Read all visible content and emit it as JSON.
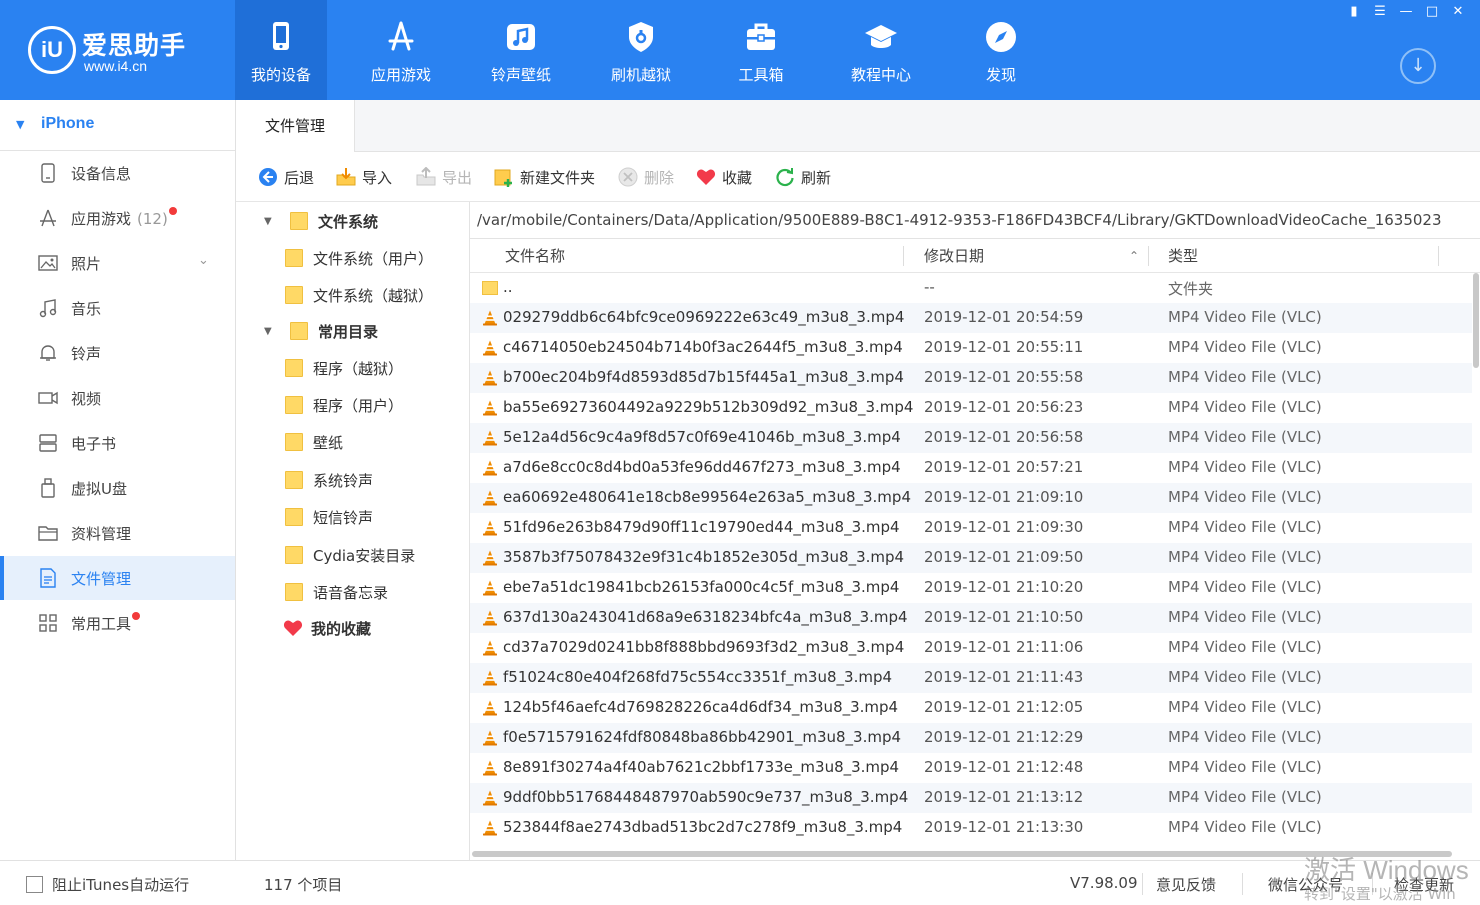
{
  "app": {
    "logo_mark": "iU",
    "logo_name": "爱思助手",
    "logo_url": "www.i4.cn"
  },
  "nav": [
    {
      "label": "我的设备",
      "icon": "phone-icon"
    },
    {
      "label": "应用游戏",
      "icon": "appstore-icon"
    },
    {
      "label": "铃声壁纸",
      "icon": "music-icon"
    },
    {
      "label": "刷机越狱",
      "icon": "shield-icon"
    },
    {
      "label": "工具箱",
      "icon": "toolbox-icon"
    },
    {
      "label": "教程中心",
      "icon": "graduation-cap-icon"
    },
    {
      "label": "发现",
      "icon": "compass-icon"
    }
  ],
  "sidebar": {
    "device_name": "iPhone",
    "items": [
      {
        "label": "设备信息",
        "icon": "device-info-icon"
      },
      {
        "label": "应用游戏",
        "icon": "apps-icon",
        "count": "(12)",
        "badge": true
      },
      {
        "label": "照片",
        "icon": "photo-icon",
        "expandable": true
      },
      {
        "label": "音乐",
        "icon": "music-note-icon"
      },
      {
        "label": "铃声",
        "icon": "bell-icon"
      },
      {
        "label": "视频",
        "icon": "video-icon"
      },
      {
        "label": "电子书",
        "icon": "ebook-icon"
      },
      {
        "label": "虚拟U盘",
        "icon": "usb-drive-icon"
      },
      {
        "label": "资料管理",
        "icon": "folder-icon"
      },
      {
        "label": "文件管理",
        "icon": "file-manager-icon",
        "active": true
      },
      {
        "label": "常用工具",
        "icon": "grid-tools-icon",
        "badge": true
      }
    ]
  },
  "tabs": {
    "active": "文件管理"
  },
  "toolbar": {
    "back": "后退",
    "import": "导入",
    "export": "导出",
    "new_folder": "新建文件夹",
    "delete": "删除",
    "favorite": "收藏",
    "refresh": "刷新"
  },
  "tree": {
    "filesystem": "文件系统",
    "fs_user": "文件系统（用户）",
    "fs_jailbreak": "文件系统（越狱）",
    "common_dirs": "常用目录",
    "apps_jailbreak": "程序（越狱）",
    "apps_user": "程序（用户）",
    "wallpaper": "壁纸",
    "system_ringtones": "系统铃声",
    "sms_ringtones": "短信铃声",
    "cydia": "Cydia安装目录",
    "voice_memos": "语音备忘录",
    "favorites": "我的收藏"
  },
  "path": "/var/mobile/Containers/Data/Application/9500E889-B8C1-4912-9353-F186FD43BCF4/Library/GKTDownloadVideoCache_1635023",
  "table": {
    "columns": {
      "name": "文件名称",
      "date": "修改日期",
      "type": "类型"
    },
    "rows": [
      {
        "name": "..",
        "date": "--",
        "type": "文件夹",
        "kind": "folder"
      },
      {
        "name": "029279ddb6c64bfc9ce0969222e63c49_m3u8_3.mp4",
        "date": "2019-12-01 20:54:59",
        "type": "MP4 Video File (VLC)",
        "kind": "vlc"
      },
      {
        "name": "c46714050eb24504b714b0f3ac2644f5_m3u8_3.mp4",
        "date": "2019-12-01 20:55:11",
        "type": "MP4 Video File (VLC)",
        "kind": "vlc"
      },
      {
        "name": "b700ec204b9f4d8593d85d7b15f445a1_m3u8_3.mp4",
        "date": "2019-12-01 20:55:58",
        "type": "MP4 Video File (VLC)",
        "kind": "vlc"
      },
      {
        "name": "ba55e69273604492a9229b512b309d92_m3u8_3.mp4",
        "date": "2019-12-01 20:56:23",
        "type": "MP4 Video File (VLC)",
        "kind": "vlc"
      },
      {
        "name": "5e12a4d56c9c4a9f8d57c0f69e41046b_m3u8_3.mp4",
        "date": "2019-12-01 20:56:58",
        "type": "MP4 Video File (VLC)",
        "kind": "vlc"
      },
      {
        "name": "a7d6e8cc0c8d4bd0a53fe96dd467f273_m3u8_3.mp4",
        "date": "2019-12-01 20:57:21",
        "type": "MP4 Video File (VLC)",
        "kind": "vlc"
      },
      {
        "name": "ea60692e480641e18cb8e99564e263a5_m3u8_3.mp4",
        "date": "2019-12-01 21:09:10",
        "type": "MP4 Video File (VLC)",
        "kind": "vlc"
      },
      {
        "name": "51fd96e263b8479d90ff11c19790ed44_m3u8_3.mp4",
        "date": "2019-12-01 21:09:30",
        "type": "MP4 Video File (VLC)",
        "kind": "vlc"
      },
      {
        "name": "3587b3f75078432e9f31c4b1852e305d_m3u8_3.mp4",
        "date": "2019-12-01 21:09:50",
        "type": "MP4 Video File (VLC)",
        "kind": "vlc"
      },
      {
        "name": "ebe7a51dc19841bcb26153fa000c4c5f_m3u8_3.mp4",
        "date": "2019-12-01 21:10:20",
        "type": "MP4 Video File (VLC)",
        "kind": "vlc"
      },
      {
        "name": "637d130a243041d68a9e6318234bfc4a_m3u8_3.mp4",
        "date": "2019-12-01 21:10:50",
        "type": "MP4 Video File (VLC)",
        "kind": "vlc"
      },
      {
        "name": "cd37a7029d0241bb8f888bbd9693f3d2_m3u8_3.mp4",
        "date": "2019-12-01 21:11:06",
        "type": "MP4 Video File (VLC)",
        "kind": "vlc"
      },
      {
        "name": "f51024c80e404f268fd75c554cc3351f_m3u8_3.mp4",
        "date": "2019-12-01 21:11:43",
        "type": "MP4 Video File (VLC)",
        "kind": "vlc"
      },
      {
        "name": "124b5f46aefc4d769828226ca4d6df34_m3u8_3.mp4",
        "date": "2019-12-01 21:12:05",
        "type": "MP4 Video File (VLC)",
        "kind": "vlc"
      },
      {
        "name": "f0e5715791624fdf80848ba86bb42901_m3u8_3.mp4",
        "date": "2019-12-01 21:12:29",
        "type": "MP4 Video File (VLC)",
        "kind": "vlc"
      },
      {
        "name": "8e891f30274a4f40ab7621c2bbf1733e_m3u8_3.mp4",
        "date": "2019-12-01 21:12:48",
        "type": "MP4 Video File (VLC)",
        "kind": "vlc"
      },
      {
        "name": "9ddf0bb51768448487970ab590c9e737_m3u8_3.mp4",
        "date": "2019-12-01 21:13:12",
        "type": "MP4 Video File (VLC)",
        "kind": "vlc"
      },
      {
        "name": "523844f8ae2743dbad513bc2d7c278f9_m3u8_3.mp4",
        "date": "2019-12-01 21:13:30",
        "type": "MP4 Video File (VLC)",
        "kind": "vlc"
      }
    ]
  },
  "statusbar": {
    "itunes_block": "阻止iTunes自动运行",
    "item_count": "117 个项目",
    "version": "V7.98.09",
    "feedback": "意见反馈",
    "wechat": "微信公众号",
    "check_update": "检查更新"
  },
  "watermark": {
    "line1": "激活 Windows",
    "line2": "转到\"设置\"以激活 Win"
  },
  "colors": {
    "brand": "#2a82f1",
    "nav_active": "#1f6fd8",
    "badge": "#f23a3a",
    "folder": "#ffd966",
    "vlc": "#f08c00"
  }
}
